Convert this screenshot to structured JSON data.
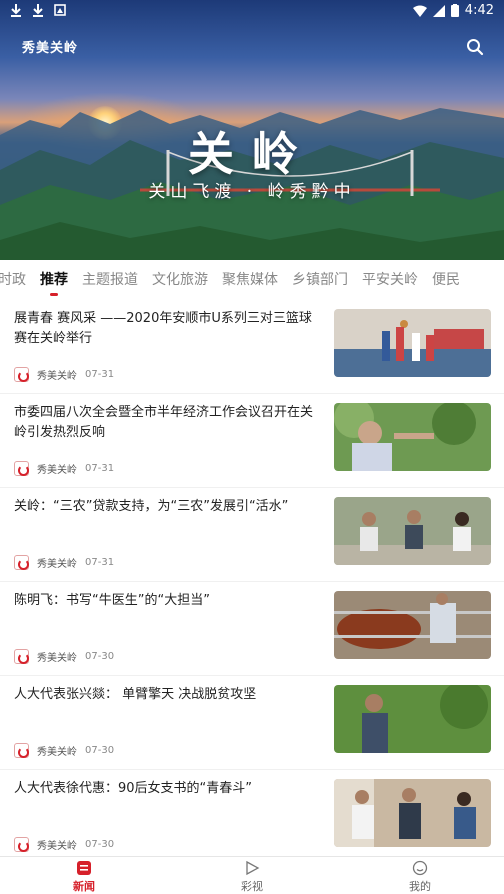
{
  "status_bar": {
    "time": "4:42",
    "left_icons": [
      "download-icon",
      "download-icon",
      "image-icon"
    ],
    "right_icons": [
      "wifi-icon",
      "signal-icon",
      "battery-icon"
    ]
  },
  "header": {
    "app_name": "秀美关岭",
    "hero_title": "关岭",
    "hero_subtitle": "关山飞渡 · 岭秀黔中",
    "search_icon": "search-icon"
  },
  "tabs": {
    "active_index": 1,
    "items": [
      "时政",
      "推荐",
      "主题报道",
      "文化旅游",
      "聚焦媒体",
      "乡镇部门",
      "平安关岭",
      "便民"
    ]
  },
  "news": [
    {
      "title": "展青春 赛风采 ——2020年安顺市U系列三对三篮球赛在关岭举行",
      "source": "秀美关岭",
      "date": "07-31",
      "thumb": "basketball-photo"
    },
    {
      "title": "市委四届八次全会暨全市半年经济工作会议召开在关岭引发热烈反响",
      "source": "秀美关岭",
      "date": "07-31",
      "thumb": "orchard-photo"
    },
    {
      "title": "关岭：“三农”贷款支持，为“三农”发展引“活水”",
      "source": "秀美关岭",
      "date": "07-31",
      "thumb": "meeting-photo"
    },
    {
      "title": "陈明飞：书写“牛医生”的“大担当”",
      "source": "秀美关岭",
      "date": "07-30",
      "thumb": "cattle-photo"
    },
    {
      "title": "人大代表张兴燚： 单臂擎天 决战脱贫攻坚",
      "source": "秀美关岭",
      "date": "07-30",
      "thumb": "farmer-photo"
    },
    {
      "title": "人大代表徐代惠：90后女支书的“青春斗”",
      "source": "秀美关岭",
      "date": "07-30",
      "thumb": "visit-photo"
    }
  ],
  "bottom_nav": [
    {
      "label": "新闻",
      "icon": "news-icon",
      "active": true
    },
    {
      "label": "彩视",
      "icon": "play-icon",
      "active": false
    },
    {
      "label": "我的",
      "icon": "profile-icon",
      "active": false
    }
  ],
  "colors": {
    "accent": "#d6202a"
  }
}
